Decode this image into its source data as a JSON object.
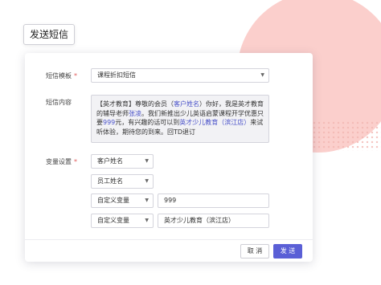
{
  "header": {
    "send_sms_label": "发送短信"
  },
  "form": {
    "template_label": "短信模板",
    "required_mark": "*",
    "template_value": "课程折扣短信",
    "content_label": "短信内容",
    "content": {
      "p1": "【英才教育】尊敬的会员（",
      "v1": "客户姓名",
      "p2": "）你好，我是英才教育的辅导老师",
      "v2": "张凌",
      "p3": "。我们新推出少儿英语启蒙课程开学优惠只要",
      "v3": "999",
      "p4": "元，有兴趣的话可以到",
      "v4": "英才少儿教育（滨江店）",
      "p5": "来试听体验，期待您的到来。回TD退订"
    },
    "variables_label": "变量设置",
    "variables": [
      {
        "type": "客户姓名"
      },
      {
        "type": "员工姓名"
      },
      {
        "type": "自定义变量",
        "value": "999"
      },
      {
        "type": "自定义变量",
        "value": "英才少儿教育（滨江店）"
      }
    ]
  },
  "footer": {
    "cancel_label": "取 消",
    "send_label": "发 送"
  },
  "colors": {
    "accent": "#5a5fd6",
    "required": "#e05a5a",
    "decor_circle": "#fbcfcc"
  },
  "icons": {
    "dropdown": "chevron-down-icon"
  }
}
